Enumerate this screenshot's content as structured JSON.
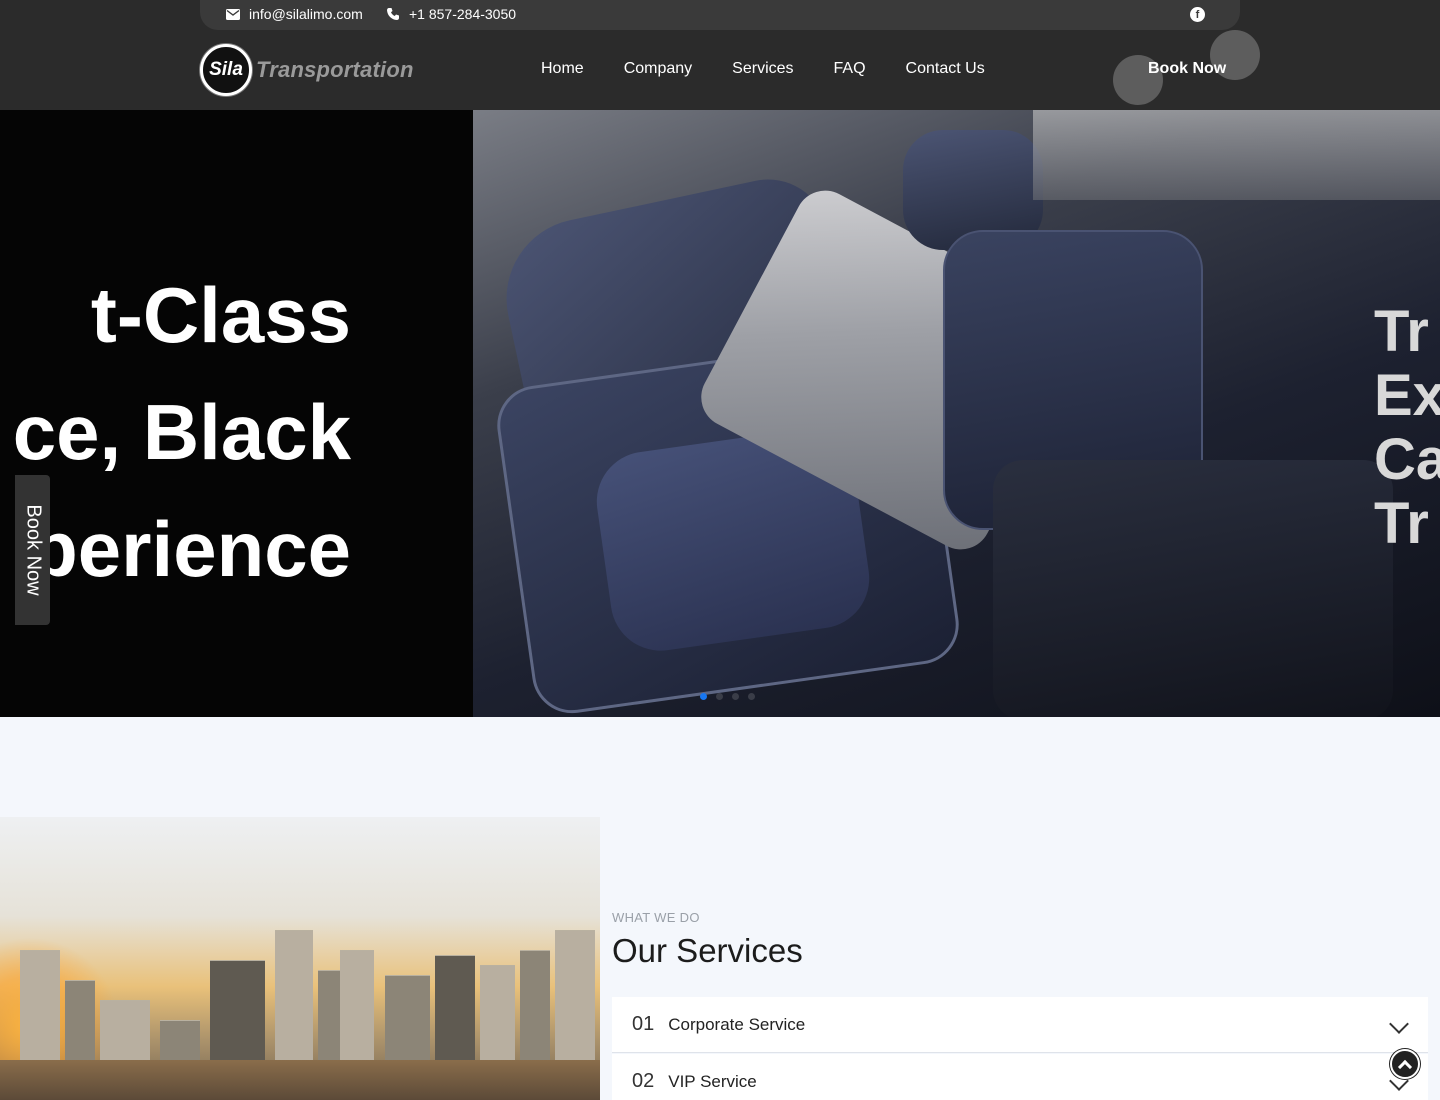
{
  "topbar": {
    "email": "info@silalimo.com",
    "phone": "+1 857-284-3050",
    "social": "facebook-icon"
  },
  "logo": {
    "mark": "Sila",
    "word": "Transportation"
  },
  "nav": {
    "items": [
      "Home",
      "Company",
      "Services",
      "FAQ",
      "Contact Us"
    ],
    "cta": "Book Now"
  },
  "hero": {
    "title_lines": [
      "t-Class",
      "ce, Black",
      "perience"
    ],
    "next_slide_lines": [
      "Tr",
      "Ex",
      "Ca",
      "Tr"
    ],
    "slide_count": 4,
    "active_slide": 1
  },
  "side_cta": "Book Now",
  "services": {
    "eyebrow": "WHAT WE DO",
    "title": "Our Services",
    "items": [
      {
        "num": "01",
        "label": "Corporate Service"
      },
      {
        "num": "02",
        "label": "VIP Service"
      }
    ]
  },
  "colors": {
    "header": "#2b2b2b",
    "accent": "#1877f2",
    "section_bg": "#f4f7fc"
  }
}
